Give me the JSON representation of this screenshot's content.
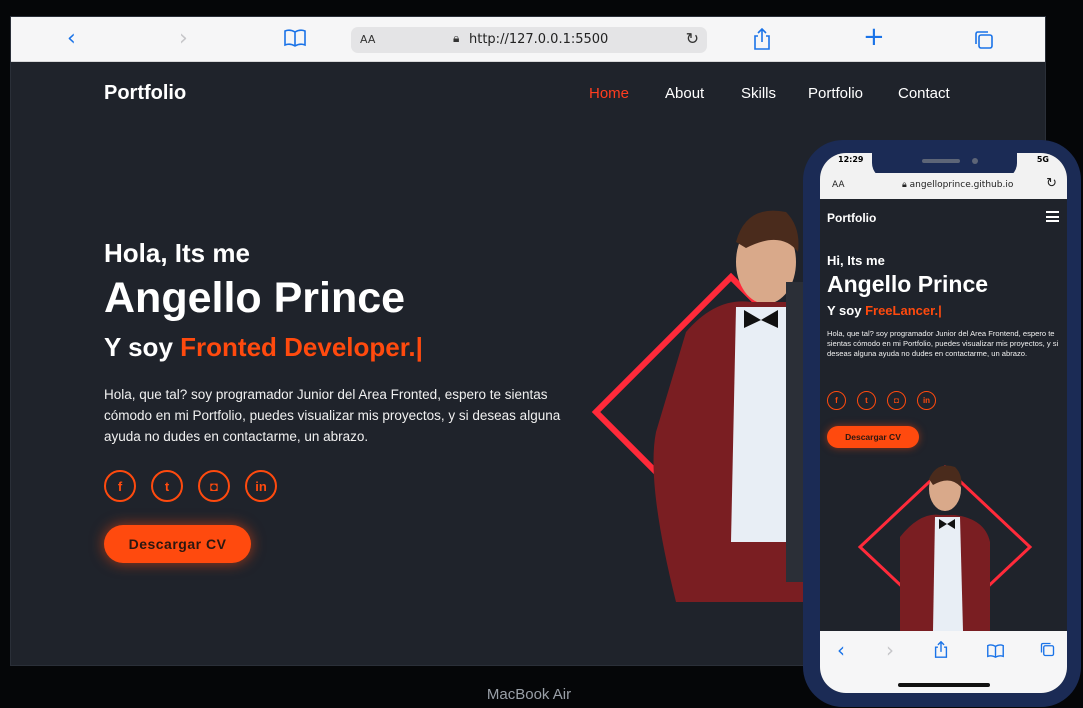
{
  "colors": {
    "accent": "#ff4a0e",
    "site_bg": "#1f232b",
    "browser_link": "#1a73e8",
    "phone_frame": "#1b2b55"
  },
  "laptop": {
    "browser": {
      "aa_label": "AA",
      "url": "http://127.0.0.1:5500",
      "icons": [
        "back-icon",
        "forward-icon",
        "bookmarks-icon",
        "lock-icon",
        "reload-icon",
        "share-icon",
        "new-tab-icon",
        "tabs-icon"
      ]
    },
    "site": {
      "logo": "Portfolio",
      "nav": [
        {
          "label": "Home",
          "active": true
        },
        {
          "label": "About",
          "active": false
        },
        {
          "label": "Skills",
          "active": false
        },
        {
          "label": "Portfolio",
          "active": false
        },
        {
          "label": "Contact",
          "active": false
        }
      ],
      "greeting": "Hola, Its me",
      "name": "Angello Prince",
      "role_prefix": "Y soy",
      "role_highlight": "Fronted Developer.",
      "role_caret": "|",
      "description": "Hola, que tal? soy programador Junior del Area Fronted, espero te sientas cómodo en mi Portfolio, puedes visualizar mis proyectos, y si deseas alguna ayuda no dudes en contactarme, un abrazo.",
      "social": [
        {
          "icon": "facebook-icon",
          "glyph": "f"
        },
        {
          "icon": "twitter-icon",
          "glyph": "t"
        },
        {
          "icon": "instagram-icon",
          "glyph": "◘"
        },
        {
          "icon": "linkedin-icon",
          "glyph": "in"
        }
      ],
      "cta": "Descargar CV"
    },
    "device_label": "MacBook Air"
  },
  "phone": {
    "status_time": "12:29",
    "status_signal": "5G",
    "browser": {
      "aa_label": "AA",
      "url": "angelloprince.github.io"
    },
    "site": {
      "logo": "Portfolio",
      "greeting": "Hi, Its me",
      "name": "Angello Prince",
      "role_prefix": "Y soy",
      "role_highlight": "FreeLancer.|",
      "description": "Hola, que tal? soy programador Junior del Area Frontend, espero te sientas cómodo en mi Portfolio, puedes visualizar mis proyectos, y si deseas alguna ayuda no dudes en contactarme, un abrazo.",
      "social": [
        {
          "icon": "facebook-icon",
          "glyph": "f"
        },
        {
          "icon": "twitter-icon",
          "glyph": "t"
        },
        {
          "icon": "instagram-icon",
          "glyph": "◘"
        },
        {
          "icon": "linkedin-icon",
          "glyph": "in"
        }
      ],
      "cta": "Descargar CV"
    },
    "toolbar_icons": [
      "back-icon",
      "forward-icon",
      "share-icon",
      "bookmarks-icon",
      "tabs-icon"
    ]
  }
}
